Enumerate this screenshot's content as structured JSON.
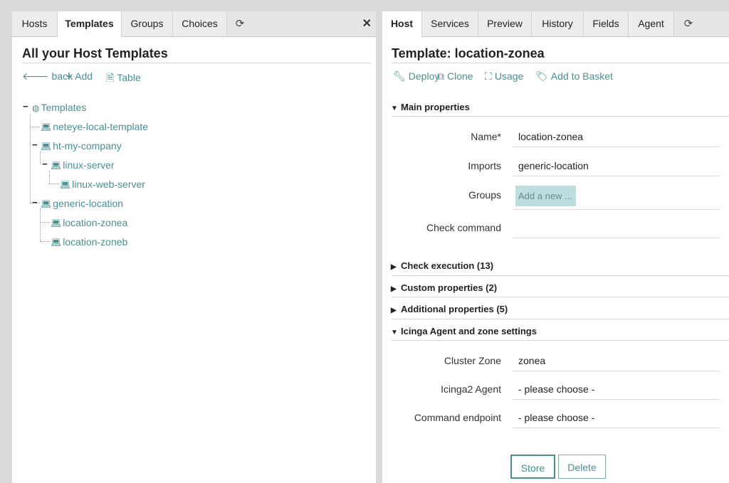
{
  "left": {
    "tabs": [
      "Hosts",
      "Templates",
      "Groups",
      "Choices"
    ],
    "title": "All your Host Templates",
    "actions": {
      "back": "back",
      "add": "Add",
      "table": "Table"
    },
    "tree": {
      "root": "Templates",
      "items": [
        "neteye-local-template",
        "ht-my-company",
        "linux-server",
        "linux-web-server",
        "generic-location",
        "location-zonea",
        "location-zoneb"
      ]
    }
  },
  "right": {
    "tabs": [
      "Host",
      "Services",
      "Preview",
      "History",
      "Fields",
      "Agent"
    ],
    "title": "Template: location-zonea",
    "actions": {
      "deploy": "Deploy",
      "clone": "Clone",
      "usage": "Usage",
      "basket": "Add to Basket"
    },
    "sections": {
      "main": "Main properties",
      "check_execution": "Check execution (13)",
      "custom": "Custom properties (2)",
      "additional": "Additional properties (5)",
      "agent": "Icinga Agent and zone settings"
    },
    "fields": {
      "name_label": "Name*",
      "name_value": "location-zonea",
      "imports_label": "Imports",
      "imports_value": "generic-location",
      "groups_label": "Groups",
      "groups_placeholder": "Add a new ...",
      "check_command_label": "Check command",
      "cluster_zone_label": "Cluster Zone",
      "cluster_zone_value": "zonea",
      "agent_label": "Icinga2 Agent",
      "agent_value": "- please choose -",
      "endpoint_label": "Command endpoint",
      "endpoint_value": "- please choose -"
    },
    "buttons": {
      "store": "Store",
      "delete": "Delete"
    }
  }
}
